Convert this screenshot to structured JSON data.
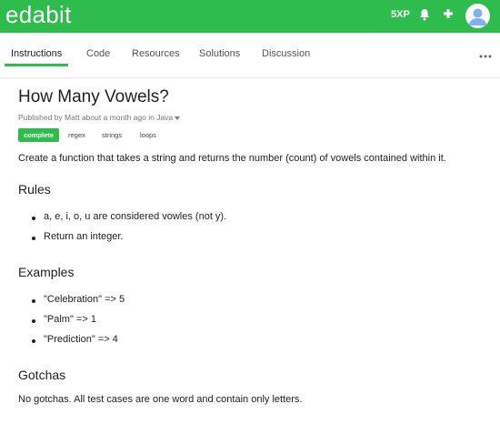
{
  "header": {
    "logo": "edabit",
    "xp": "5XP",
    "icons": {
      "notifications": "bell-icon",
      "add": "plus-icon",
      "avatar": "user-avatar-icon"
    },
    "colors": {
      "brand": "#2ebd4d",
      "icon": "#ffffff"
    }
  },
  "tabs": {
    "items": [
      {
        "label": "Instructions",
        "active": true
      },
      {
        "label": "Code",
        "active": false
      },
      {
        "label": "Resources",
        "active": false
      },
      {
        "label": "Solutions",
        "active": false
      },
      {
        "label": "Discussion",
        "active": false
      }
    ],
    "more_icon": "more-dots-icon"
  },
  "challenge": {
    "title": "How Many Vowels?",
    "meta": {
      "published_by": "Published by",
      "author": "Matt",
      "time": "about a month ago in",
      "language": "Java"
    },
    "tags": [
      {
        "label": "complete",
        "primary": true
      },
      {
        "label": "regex",
        "primary": false
      },
      {
        "label": "strings",
        "primary": false
      },
      {
        "label": "loops",
        "primary": false
      }
    ],
    "description": "Create a function that takes a string and returns the number (count) of vowels contained within it.",
    "rules": {
      "heading": "Rules",
      "items": [
        "a, e, i, o, u are considered vowles (not y).",
        "Return an integer."
      ]
    },
    "examples": {
      "heading": "Examples",
      "items": [
        "\"Celebration\" => 5",
        "\"Palm\" => 1",
        "\"Prediction\" => 4"
      ]
    },
    "gotchas": {
      "heading": "Gotchas",
      "text": "No gotchas. All test cases are one word and contain only letters."
    }
  }
}
